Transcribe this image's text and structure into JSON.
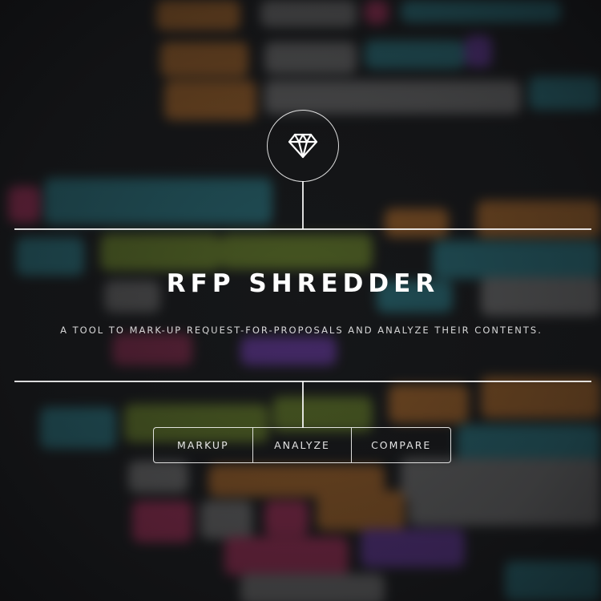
{
  "header": {
    "logo_icon": "diamond-icon"
  },
  "hero": {
    "title": "RFP SHREDDER",
    "subtitle": "A TOOL TO MARK-UP REQUEST-FOR-PROPOSALS AND ANALYZE THEIR CONTENTS."
  },
  "nav": {
    "items": [
      {
        "label": "MARKUP"
      },
      {
        "label": "ANALYZE"
      },
      {
        "label": "COMPARE"
      }
    ]
  },
  "colors": {
    "background": "#16181a",
    "foreground": "#ffffff",
    "code_orange": "#c8782c",
    "code_teal": "#2c8a96",
    "code_green": "#6f8a2a",
    "code_pink": "#c2336e",
    "code_purple": "#7b3cc0",
    "code_gray": "#8a8a8a"
  }
}
